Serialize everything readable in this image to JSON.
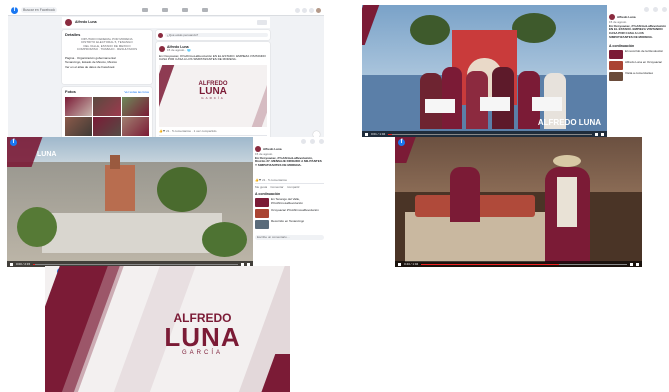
{
  "brand": {
    "line1": "ALFREDO",
    "line2": "LUNA",
    "line3": "GARCÍA",
    "colors": {
      "maroon": "#7b1b36",
      "fb_blue": "#1877f2",
      "bg": "#f0f2f5"
    }
  },
  "shot1": {
    "search_placeholder": "Buscar en Facebook",
    "profile_name": "Alfredo Luna",
    "intro_title": "Detalles",
    "intro_lines": [
      "DIPUTADO FEDERAL POR MORENA",
      "DISTRITO ELECTORAL 5, TENANGO",
      "DEL VALLE, ESTADO DE MÉXICO",
      "COMPROMISO · TRABAJO · RESULTADOS"
    ],
    "details": [
      "Página · Organización gubernamental",
      "Tenancingo, Estado de México, México",
      "Ver en el atlas de datos de Facebook"
    ],
    "photos_title": "Fotos",
    "photos_link": "Ver todas las fotos",
    "post_author": "Alfredo Luna",
    "post_meta": "15 de agosto · 🌐",
    "post_text": "En Ocoyoacac, #YoAfirmoLaRevolución EN EL ESTADO. EMPIEZA VISITANDO CASA POR CASA A LOS SIMPATIZANTES DE MORENA.",
    "post_stats": "👍❤ 21  ·  5 comentarios · 1 vez compartido",
    "actions": [
      "Me gusta",
      "Comentar",
      "Compartir"
    ],
    "composer": "¿Qué estás pensando?"
  },
  "shot2": {
    "channel": "Alfredo Luna",
    "date": "15 de agosto",
    "title": "En Ocoyoacac, #YoAfirmoLaRevolución EN EL ESTADO. EMPIEZA VISITANDO CASA POR CASA A LOS SIMPATIZANTES DE MORENA.",
    "section": "A continuación",
    "up_next": [
      "El recorrido de la Revolución",
      "Alfredo Luna en Ocoyoacac",
      "Visita a comerciantes"
    ],
    "time": "0:01 / 1:04"
  },
  "shot3": {
    "channel": "Alfredo Luna",
    "date": "15 de agosto",
    "title": "En Ocoyoacac, #YoAfirmoLaRevolución, Distrito 27. MENSAJE DIRIGIDO A MILITANTES Y SIMPATIZANTES DE MORENA.",
    "stats": "👍❤ 21 · 5 comentarios",
    "actions": [
      "Me gusta",
      "Comentar",
      "Compartir"
    ],
    "section": "A continuación",
    "up_next": [
      "En Tenango del Valle, #YoAfirmoLaRevolución",
      "Ocoyoacac #YoAfirmoLaRevolución",
      "Recorrido en Tenancingo"
    ],
    "comment_placeholder": "Escribe un comentario…",
    "time": "0:00 / 2:15"
  },
  "shot4": {
    "time": "0:43 / 1:04"
  },
  "shot5": {}
}
